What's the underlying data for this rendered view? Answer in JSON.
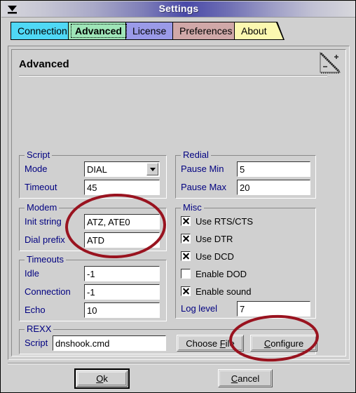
{
  "window": {
    "title": "Settings",
    "sysmenu_icon": "window-menu-arrow-icon"
  },
  "tabs": [
    {
      "label": "Connection",
      "color": "#4fd8f5",
      "selected": false
    },
    {
      "label": "Advanced",
      "color": "#9fe5b8",
      "selected": true
    },
    {
      "label": "License",
      "color": "#9a9ae8",
      "selected": false
    },
    {
      "label": "Preferences",
      "color": "#d0a8a8",
      "selected": false
    },
    {
      "label": "About",
      "color": "#fbf8b0",
      "selected": false
    }
  ],
  "panel": {
    "title": "Advanced",
    "resize_icon": "resize-zoom-icon"
  },
  "groups": {
    "script": {
      "title": "Script",
      "mode_label": "Mode",
      "mode_value": "DIAL",
      "timeout_label": "Timeout",
      "timeout_value": "45"
    },
    "redial": {
      "title": "Redial",
      "pause_min_label": "Pause Min",
      "pause_min_value": "5",
      "pause_max_label": "Pause Max",
      "pause_max_value": "20"
    },
    "modem": {
      "title": "Modem",
      "init_string_label": "Init string",
      "init_string_value": "ATZ, ATE0",
      "dial_prefix_label": "Dial prefix",
      "dial_prefix_value": "ATD"
    },
    "misc": {
      "title": "Misc",
      "checkboxes": [
        {
          "label": "Use RTS/CTS",
          "checked": true
        },
        {
          "label": "Use DTR",
          "checked": true
        },
        {
          "label": "Use DCD",
          "checked": true
        },
        {
          "label": "Enable DOD",
          "checked": false
        },
        {
          "label": "Enable sound",
          "checked": true
        }
      ],
      "log_level_label": "Log level",
      "log_level_value": "7"
    },
    "timeouts": {
      "title": "Timeouts",
      "idle_label": "Idle",
      "idle_value": "-1",
      "connection_label": "Connection",
      "connection_value": "-1",
      "echo_label": "Echo",
      "echo_value": "10"
    },
    "rexx": {
      "title": "REXX",
      "script_label": "Script",
      "script_value": "dnshook.cmd",
      "choose_file_button": {
        "pre": "Choose ",
        "mnemonic": "F",
        "post": "ile"
      },
      "configure_button": {
        "pre": "",
        "mnemonic": "C",
        "post": "onfigure"
      }
    }
  },
  "footer": {
    "ok_button": {
      "pre": "O",
      "mnemonic": "k",
      "post": ""
    },
    "cancel_button": {
      "pre": "",
      "mnemonic": "C",
      "post": "ancel"
    }
  },
  "annotations": {
    "color": "#99131f",
    "modem_circle_label": "modem-fields-highlight",
    "configure_circle_label": "configure-button-highlight"
  }
}
